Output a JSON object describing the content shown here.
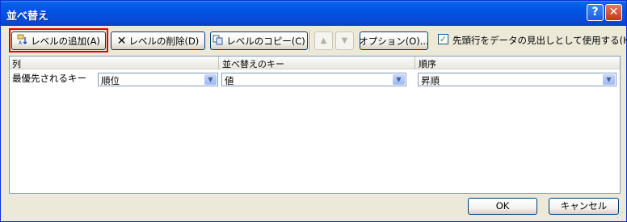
{
  "window": {
    "title": "並べ替え",
    "help_label": "?",
    "close_label": "✕"
  },
  "toolbar": {
    "add_level": "レベルの追加(A)",
    "delete_level": "レベルの削除(D)",
    "copy_level": "レベルのコピー(C)",
    "move_up_icon": "▲",
    "move_down_icon": "▼",
    "options": "オプション(O)...",
    "header_checkbox_label": "先頭行をデータの見出しとして使用する(H)",
    "header_checkbox_checked": true
  },
  "grid": {
    "columns": [
      "列",
      "並べ替えのキー",
      "順序"
    ],
    "rows": [
      {
        "label": "最優先されるキー",
        "column": "順位",
        "sort_on": "値",
        "order": "昇順"
      }
    ]
  },
  "footer": {
    "ok": "OK",
    "cancel": "キャンセル"
  },
  "colors": {
    "title_bar": "#0055e5",
    "dialog_bg": "#ece9d8",
    "highlight": "#e20000"
  }
}
